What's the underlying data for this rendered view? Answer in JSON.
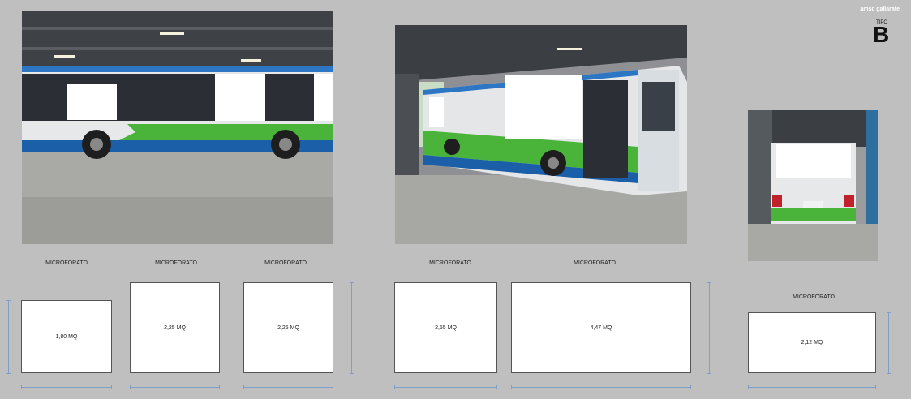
{
  "brand": "amsc gallarate",
  "tipo": {
    "label": "TIPO",
    "letter": "B"
  },
  "colors": {
    "bus_green": "#49b33a",
    "bus_blue": "#1a5fa8",
    "background": "#bfbfbf",
    "dimension_line": "#7f9fc8"
  },
  "photos": [
    {
      "name": "bus-side-view-photo"
    },
    {
      "name": "bus-three-quarter-view-photo"
    },
    {
      "name": "bus-rear-view-photo"
    }
  ],
  "panels": [
    {
      "label": "MICROFORATO",
      "area": "1,80 MQ"
    },
    {
      "label": "MICROFORATO",
      "area": "2,25 MQ"
    },
    {
      "label": "MICROFORATO",
      "area": "2,25 MQ"
    },
    {
      "label": "MICROFORATO",
      "area": "2,55 MQ"
    },
    {
      "label": "MICROFORATO",
      "area": "4,47 MQ"
    },
    {
      "label": "MICROFORATO",
      "area": "2,12 MQ"
    }
  ]
}
